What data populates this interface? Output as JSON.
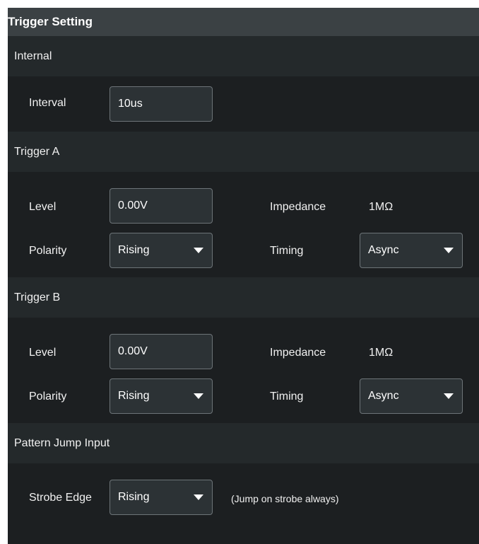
{
  "title": "Trigger Setting",
  "internal": {
    "header": "Internal",
    "interval_label": "Interval",
    "interval_value": "10us"
  },
  "trigger_a": {
    "header": "Trigger A",
    "level_label": "Level",
    "level_value": "0.00V",
    "impedance_label": "Impedance",
    "impedance_value": "1MΩ",
    "polarity_label": "Polarity",
    "polarity_value": "Rising",
    "timing_label": "Timing",
    "timing_value": "Async"
  },
  "trigger_b": {
    "header": "Trigger B",
    "level_label": "Level",
    "level_value": "0.00V",
    "impedance_label": "Impedance",
    "impedance_value": "1MΩ",
    "polarity_label": "Polarity",
    "polarity_value": "Rising",
    "timing_label": "Timing",
    "timing_value": "Async"
  },
  "pattern_jump": {
    "header": "Pattern Jump Input",
    "strobe_edge_label": "Strobe Edge",
    "strobe_edge_value": "Rising",
    "note": "(Jump on strobe always)"
  },
  "icons": {
    "dropdown": "chevron-down-icon"
  },
  "colors": {
    "background": "#1c1f21",
    "title_bar": "#3b4144",
    "section_header": "#24292b",
    "field": "#2c3235",
    "field_border": "#6d7478",
    "text": "#ffffff"
  }
}
